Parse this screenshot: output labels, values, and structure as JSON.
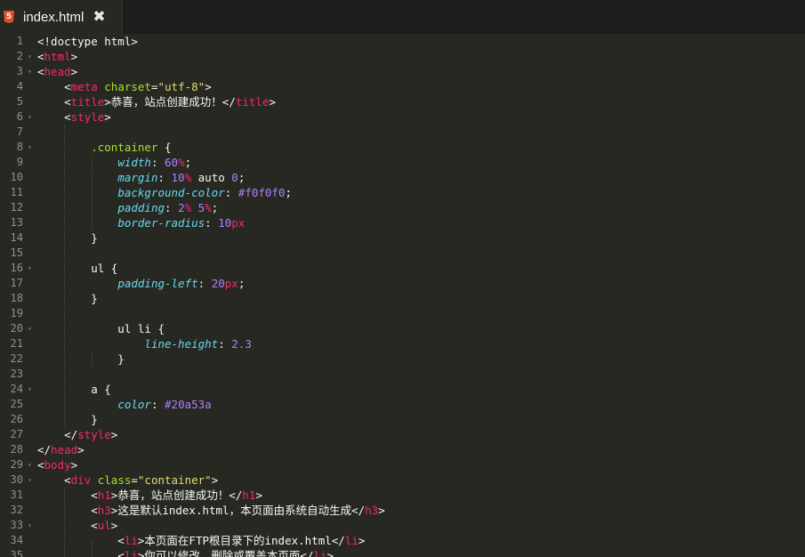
{
  "tab": {
    "icon": "html5-file-icon",
    "icon_glyph": "5",
    "title": "index.html",
    "close_glyph": "✖"
  },
  "lines": [
    {
      "n": "1",
      "fold": false,
      "tokens": [
        {
          "t": "<!doctype html>",
          "c": "p"
        }
      ]
    },
    {
      "n": "2",
      "fold": true,
      "tokens": [
        {
          "t": "<",
          "c": "p"
        },
        {
          "t": "html",
          "c": "tag"
        },
        {
          "t": ">",
          "c": "p"
        }
      ]
    },
    {
      "n": "3",
      "fold": true,
      "tokens": [
        {
          "t": "<",
          "c": "p"
        },
        {
          "t": "head",
          "c": "tag"
        },
        {
          "t": ">",
          "c": "p"
        }
      ]
    },
    {
      "n": "4",
      "fold": false,
      "tokens": [
        {
          "t": "    <",
          "c": "p"
        },
        {
          "t": "meta",
          "c": "tag"
        },
        {
          "t": " charset",
          "c": "attr"
        },
        {
          "t": "=",
          "c": "p"
        },
        {
          "t": "\"utf-8\"",
          "c": "str"
        },
        {
          "t": ">",
          "c": "p"
        }
      ]
    },
    {
      "n": "5",
      "fold": false,
      "tokens": [
        {
          "t": "    <",
          "c": "p"
        },
        {
          "t": "title",
          "c": "tag"
        },
        {
          "t": ">恭喜，站点创建成功！</",
          "c": "p"
        },
        {
          "t": "title",
          "c": "tag"
        },
        {
          "t": ">",
          "c": "p"
        }
      ]
    },
    {
      "n": "6",
      "fold": true,
      "tokens": [
        {
          "t": "    <",
          "c": "p"
        },
        {
          "t": "style",
          "c": "tag"
        },
        {
          "t": ">",
          "c": "p"
        }
      ]
    },
    {
      "n": "7",
      "fold": false,
      "tokens": []
    },
    {
      "n": "8",
      "fold": true,
      "tokens": [
        {
          "t": "        .container",
          "c": "sel"
        },
        {
          "t": " {",
          "c": "p"
        }
      ]
    },
    {
      "n": "9",
      "fold": false,
      "tokens": [
        {
          "t": "            ",
          "c": "p"
        },
        {
          "t": "width",
          "c": "prop"
        },
        {
          "t": ": ",
          "c": "p"
        },
        {
          "t": "60",
          "c": "num"
        },
        {
          "t": "%",
          "c": "tag"
        },
        {
          "t": ";",
          "c": "p"
        }
      ]
    },
    {
      "n": "10",
      "fold": false,
      "tokens": [
        {
          "t": "            ",
          "c": "p"
        },
        {
          "t": "margin",
          "c": "prop"
        },
        {
          "t": ": ",
          "c": "p"
        },
        {
          "t": "10",
          "c": "num"
        },
        {
          "t": "%",
          "c": "tag"
        },
        {
          "t": " auto ",
          "c": "p"
        },
        {
          "t": "0",
          "c": "num"
        },
        {
          "t": ";",
          "c": "p"
        }
      ]
    },
    {
      "n": "11",
      "fold": false,
      "tokens": [
        {
          "t": "            ",
          "c": "p"
        },
        {
          "t": "background-color",
          "c": "prop"
        },
        {
          "t": ": ",
          "c": "p"
        },
        {
          "t": "#f0f0f0",
          "c": "num"
        },
        {
          "t": ";",
          "c": "p"
        }
      ]
    },
    {
      "n": "12",
      "fold": false,
      "tokens": [
        {
          "t": "            ",
          "c": "p"
        },
        {
          "t": "padding",
          "c": "prop"
        },
        {
          "t": ": ",
          "c": "p"
        },
        {
          "t": "2",
          "c": "num"
        },
        {
          "t": "%",
          "c": "tag"
        },
        {
          "t": " ",
          "c": "p"
        },
        {
          "t": "5",
          "c": "num"
        },
        {
          "t": "%",
          "c": "tag"
        },
        {
          "t": ";",
          "c": "p"
        }
      ]
    },
    {
      "n": "13",
      "fold": false,
      "tokens": [
        {
          "t": "            ",
          "c": "p"
        },
        {
          "t": "border-radius",
          "c": "prop"
        },
        {
          "t": ": ",
          "c": "p"
        },
        {
          "t": "10",
          "c": "num"
        },
        {
          "t": "px",
          "c": "tag"
        }
      ]
    },
    {
      "n": "14",
      "fold": false,
      "tokens": [
        {
          "t": "        }",
          "c": "p"
        }
      ]
    },
    {
      "n": "15",
      "fold": false,
      "tokens": []
    },
    {
      "n": "16",
      "fold": true,
      "tokens": [
        {
          "t": "        ul",
          "c": "p"
        },
        {
          "t": " {",
          "c": "p"
        }
      ]
    },
    {
      "n": "17",
      "fold": false,
      "tokens": [
        {
          "t": "            ",
          "c": "p"
        },
        {
          "t": "padding-left",
          "c": "prop"
        },
        {
          "t": ": ",
          "c": "p"
        },
        {
          "t": "20",
          "c": "num"
        },
        {
          "t": "px",
          "c": "tag"
        },
        {
          "t": ";",
          "c": "p"
        }
      ]
    },
    {
      "n": "18",
      "fold": false,
      "tokens": [
        {
          "t": "        }",
          "c": "p"
        }
      ]
    },
    {
      "n": "19",
      "fold": false,
      "tokens": []
    },
    {
      "n": "20",
      "fold": true,
      "tokens": [
        {
          "t": "            ul li",
          "c": "p"
        },
        {
          "t": " {",
          "c": "p"
        }
      ]
    },
    {
      "n": "21",
      "fold": false,
      "tokens": [
        {
          "t": "                ",
          "c": "p"
        },
        {
          "t": "line-height",
          "c": "prop"
        },
        {
          "t": ": ",
          "c": "p"
        },
        {
          "t": "2.3",
          "c": "num"
        }
      ]
    },
    {
      "n": "22",
      "fold": false,
      "tokens": [
        {
          "t": "            }",
          "c": "p"
        }
      ]
    },
    {
      "n": "23",
      "fold": false,
      "tokens": []
    },
    {
      "n": "24",
      "fold": true,
      "tokens": [
        {
          "t": "        a",
          "c": "p"
        },
        {
          "t": " {",
          "c": "p"
        }
      ]
    },
    {
      "n": "25",
      "fold": false,
      "tokens": [
        {
          "t": "            ",
          "c": "p"
        },
        {
          "t": "color",
          "c": "prop"
        },
        {
          "t": ": ",
          "c": "p"
        },
        {
          "t": "#20a53a",
          "c": "num"
        }
      ]
    },
    {
      "n": "26",
      "fold": false,
      "tokens": [
        {
          "t": "        }",
          "c": "p"
        }
      ]
    },
    {
      "n": "27",
      "fold": false,
      "tokens": [
        {
          "t": "    </",
          "c": "p"
        },
        {
          "t": "style",
          "c": "tag"
        },
        {
          "t": ">",
          "c": "p"
        }
      ]
    },
    {
      "n": "28",
      "fold": false,
      "tokens": [
        {
          "t": "</",
          "c": "p"
        },
        {
          "t": "head",
          "c": "tag"
        },
        {
          "t": ">",
          "c": "p"
        }
      ]
    },
    {
      "n": "29",
      "fold": true,
      "tokens": [
        {
          "t": "<",
          "c": "p"
        },
        {
          "t": "body",
          "c": "tag"
        },
        {
          "t": ">",
          "c": "p"
        }
      ]
    },
    {
      "n": "30",
      "fold": true,
      "tokens": [
        {
          "t": "    <",
          "c": "p"
        },
        {
          "t": "div",
          "c": "tag"
        },
        {
          "t": " class",
          "c": "attr"
        },
        {
          "t": "=",
          "c": "p"
        },
        {
          "t": "\"container\"",
          "c": "str"
        },
        {
          "t": ">",
          "c": "p"
        }
      ]
    },
    {
      "n": "31",
      "fold": false,
      "tokens": [
        {
          "t": "        <",
          "c": "p"
        },
        {
          "t": "h1",
          "c": "tag"
        },
        {
          "t": ">恭喜，站点创建成功！</",
          "c": "p"
        },
        {
          "t": "h1",
          "c": "tag"
        },
        {
          "t": ">",
          "c": "p"
        }
      ]
    },
    {
      "n": "32",
      "fold": false,
      "tokens": [
        {
          "t": "        <",
          "c": "p"
        },
        {
          "t": "h3",
          "c": "tag"
        },
        {
          "t": ">这是默认index.html，本页面由系统自动生成</",
          "c": "p"
        },
        {
          "t": "h3",
          "c": "tag"
        },
        {
          "t": ">",
          "c": "p"
        }
      ]
    },
    {
      "n": "33",
      "fold": true,
      "tokens": [
        {
          "t": "        <",
          "c": "p"
        },
        {
          "t": "ul",
          "c": "tag"
        },
        {
          "t": ">",
          "c": "p"
        }
      ]
    },
    {
      "n": "34",
      "fold": false,
      "tokens": [
        {
          "t": "            <",
          "c": "p"
        },
        {
          "t": "li",
          "c": "tag"
        },
        {
          "t": ">本页面在FTP根目录下的index.html</",
          "c": "p"
        },
        {
          "t": "li",
          "c": "tag"
        },
        {
          "t": ">",
          "c": "p"
        }
      ]
    },
    {
      "n": "35",
      "fold": false,
      "tokens": [
        {
          "t": "            <",
          "c": "p"
        },
        {
          "t": "li",
          "c": "tag"
        },
        {
          "t": ">你可以修改、删除或覆盖本页面</",
          "c": "p"
        },
        {
          "t": "li",
          "c": "tag"
        },
        {
          "t": ">",
          "c": "p"
        }
      ]
    }
  ]
}
